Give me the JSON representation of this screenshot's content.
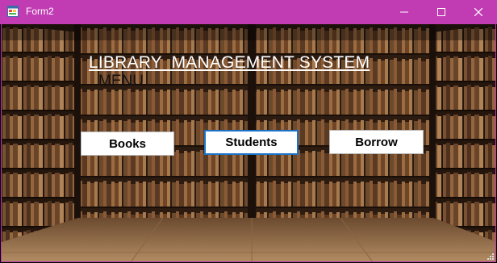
{
  "window": {
    "title": "Form2",
    "controls": {
      "minimize": "minimize",
      "maximize": "maximize",
      "close": "close"
    }
  },
  "heading": "LIBRARY  MANAGEMENT SYSTEM",
  "menu_label": "MENU",
  "buttons": {
    "books": "Books",
    "students": "Students",
    "borrow": "Borrow"
  },
  "icons": [
    "app-form-icon",
    "minimize-icon",
    "maximize-icon",
    "close-icon",
    "resize-grip-icon"
  ],
  "colors": {
    "titlebar": "#c13cb3",
    "focus_border": "#1a73c9",
    "heading_text": "#ffffff"
  }
}
